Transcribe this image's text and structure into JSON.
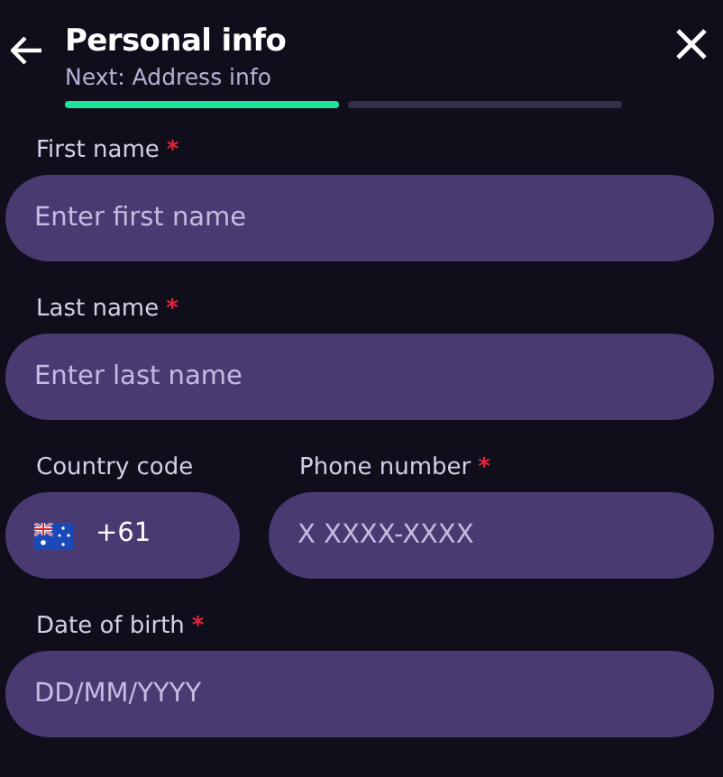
{
  "header": {
    "title": "Personal info",
    "subtitle": "Next: Address info"
  },
  "progress": [
    {
      "done": true
    },
    {
      "done": false
    }
  ],
  "rows": [
    {
      "fields": [
        {
          "label": "First name",
          "mark": "*",
          "placeholder": "Enter first name"
        }
      ]
    },
    {
      "fields": [
        {
          "label": "Last name",
          "mark": "*",
          "placeholder": "Enter last name"
        }
      ]
    },
    {
      "fields": [
        {
          "label": "Country code",
          "value": "+61",
          "kind": "country"
        },
        {
          "label": "Phone number",
          "mark": "*",
          "placeholder": "X XXXX-XXXX"
        }
      ]
    },
    {
      "fields": [
        {
          "label": "Date of birth",
          "mark": "*",
          "placeholder": "DD/MM/YYYY"
        }
      ]
    }
  ]
}
